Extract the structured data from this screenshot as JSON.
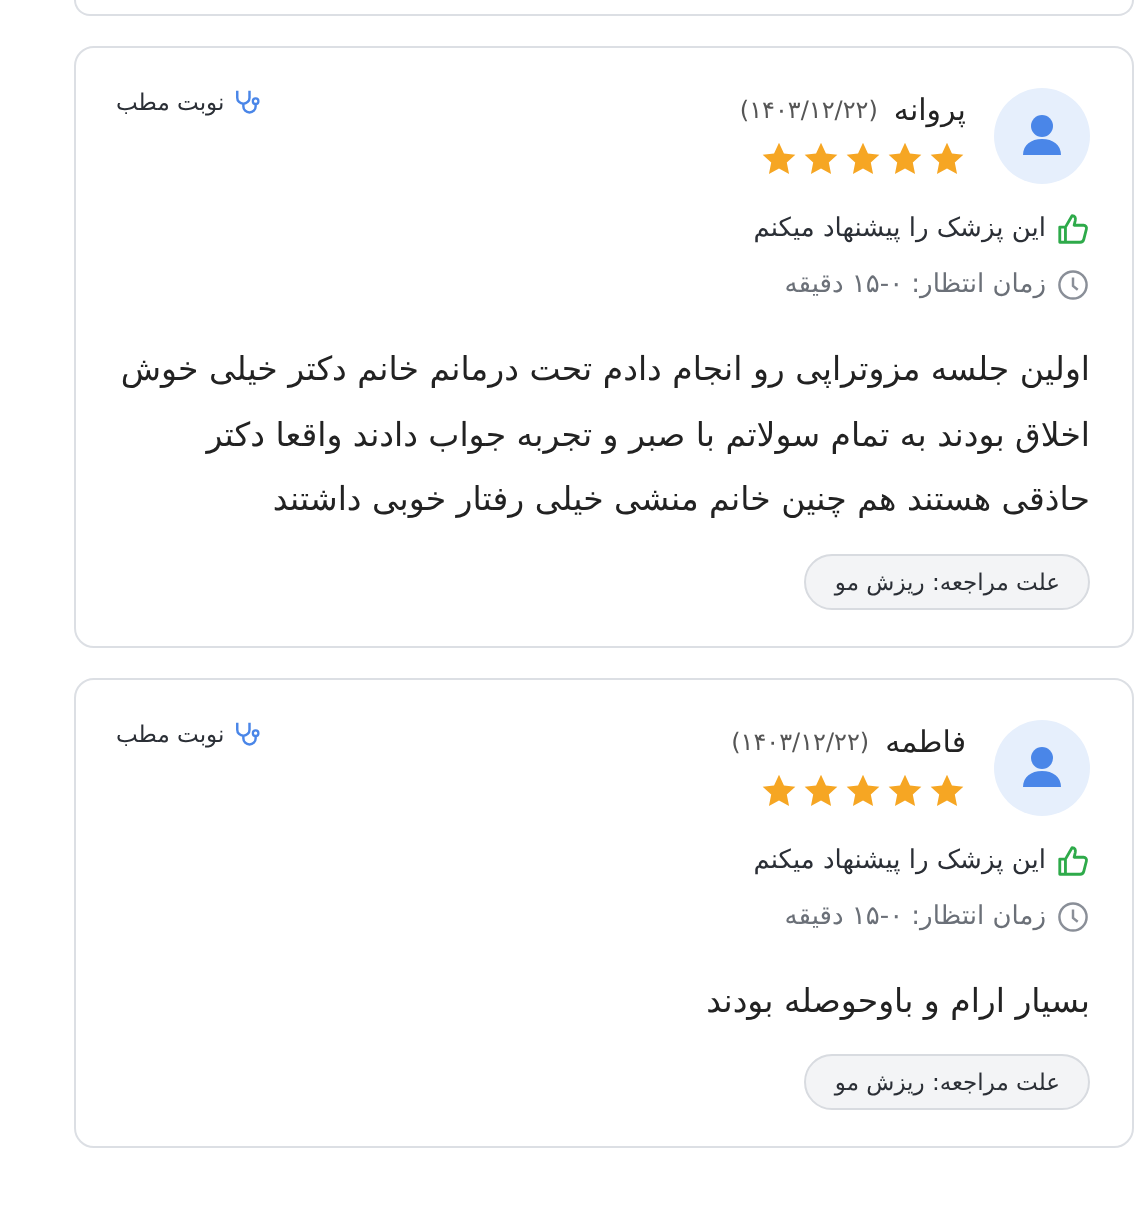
{
  "reviews": [
    {
      "name": "پروانه",
      "date": "(۱۴۰۳/۱۲/۲۲)",
      "stars": 5,
      "appointment": "نوبت مطب",
      "recommendation": "این پزشک را پیشنهاد میکنم",
      "wait_time": "زمان انتظار: ۰-۱۵ دقیقه",
      "comment": "اولین جلسه مزوتراپی رو انجام دادم تحت درمانم خانم دکتر خیلی خوش اخلاق بودند به تمام سولاتم با صبر و تجربه جواب دادند واقعا دکتر حاذقی هستند هم چنین خانم منشی خیلی رفتار خوبی داشتند",
      "reason": "علت مراجعه: ریزش مو"
    },
    {
      "name": "فاطمه",
      "date": "(۱۴۰۳/۱۲/۲۲)",
      "stars": 5,
      "appointment": "نوبت مطب",
      "recommendation": "این پزشک را پیشنهاد میکنم",
      "wait_time": "زمان انتظار: ۰-۱۵ دقیقه",
      "comment": "بسیار ارام و باوحوصله بودند",
      "reason": "علت مراجعه: ریزش مو"
    }
  ]
}
